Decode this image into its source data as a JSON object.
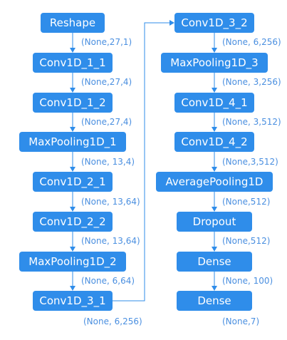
{
  "nodes": [
    {
      "id": "reshape",
      "label": "Reshape"
    },
    {
      "id": "conv1d_1_1",
      "label": "Conv1D_1_1"
    },
    {
      "id": "conv1d_1_2",
      "label": "Conv1D_1_2"
    },
    {
      "id": "maxpool_1",
      "label": "MaxPooling1D_1"
    },
    {
      "id": "conv1d_2_1",
      "label": "Conv1D_2_1"
    },
    {
      "id": "conv1d_2_2",
      "label": "Conv1D_2_2"
    },
    {
      "id": "maxpool_2",
      "label": "MaxPooling1D_2"
    },
    {
      "id": "conv1d_3_1",
      "label": "Conv1D_3_1"
    },
    {
      "id": "conv1d_3_2",
      "label": "Conv1D_3_2"
    },
    {
      "id": "maxpool_3",
      "label": "MaxPooling1D_3"
    },
    {
      "id": "conv1d_4_1",
      "label": "Conv1D_4_1"
    },
    {
      "id": "conv1d_4_2",
      "label": "Conv1D_4_2"
    },
    {
      "id": "avgpool_1d",
      "label": "AveragePooling1D"
    },
    {
      "id": "dropout",
      "label": "Dropout"
    },
    {
      "id": "dense_1",
      "label": "Dense"
    },
    {
      "id": "dense_2",
      "label": "Dense"
    }
  ],
  "edges": [
    {
      "from": "reshape",
      "to": "conv1d_1_1",
      "shape": "(None,27,1)"
    },
    {
      "from": "conv1d_1_1",
      "to": "conv1d_1_2",
      "shape": "(None,27,4)"
    },
    {
      "from": "conv1d_1_2",
      "to": "maxpool_1",
      "shape": "(None,27,4)"
    },
    {
      "from": "maxpool_1",
      "to": "conv1d_2_1",
      "shape": "(None, 13,4)"
    },
    {
      "from": "conv1d_2_1",
      "to": "conv1d_2_2",
      "shape": "(None, 13,64)"
    },
    {
      "from": "conv1d_2_2",
      "to": "maxpool_2",
      "shape": "(None, 13,64)"
    },
    {
      "from": "maxpool_2",
      "to": "conv1d_3_1",
      "shape": "(None, 6,64)"
    },
    {
      "from": "conv1d_3_1",
      "to": "conv1d_3_2",
      "shape": ""
    },
    {
      "from": "conv1d_3_2",
      "to": "maxpool_3",
      "shape": "(None, 6,256)"
    },
    {
      "from": "maxpool_3",
      "to": "conv1d_4_1",
      "shape": "(None, 3,256)"
    },
    {
      "from": "conv1d_4_1",
      "to": "conv1d_4_2",
      "shape": "(None, 3,512)"
    },
    {
      "from": "conv1d_4_2",
      "to": "avgpool_1d",
      "shape": "(None,3,512)"
    },
    {
      "from": "avgpool_1d",
      "to": "dropout",
      "shape": "(None,512)"
    },
    {
      "from": "dropout",
      "to": "dense_1",
      "shape": "(None,512)"
    },
    {
      "from": "dense_1",
      "to": "dense_2",
      "shape": "(None, 100)"
    }
  ],
  "output_shapes": [
    {
      "after": "conv1d_3_1",
      "shape": "(None, 6,256)"
    },
    {
      "after": "dense_2",
      "shape": "(None,7)"
    }
  ],
  "colors": {
    "node_fill": "#2f8dea",
    "node_text": "#ffffff",
    "edge": "#2f8dea",
    "shape_text": "#4a8fe0"
  }
}
